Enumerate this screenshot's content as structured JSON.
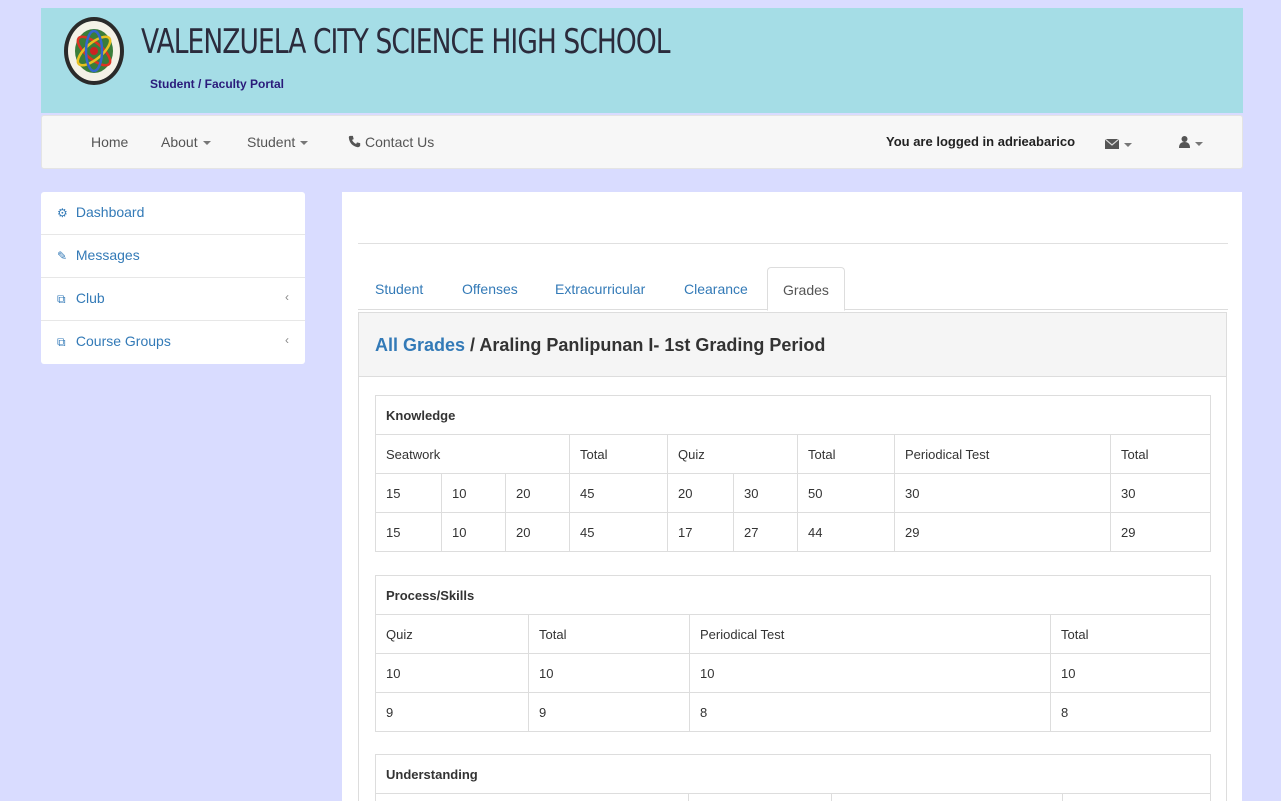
{
  "header": {
    "school_name": "VALENZUELA CITY SCIENCE HIGH SCHOOL",
    "subtitle": "Student / Faculty Portal",
    "logo_icon": "school-seal"
  },
  "nav": {
    "home": "Home",
    "about": "About",
    "student": "Student",
    "contact": "Contact Us",
    "logged_in": "You are logged in adrieabarico",
    "mail_icon": "envelope-icon",
    "user_icon": "user-icon"
  },
  "sidebar": {
    "items": [
      {
        "label": "Dashboard",
        "icon": "dashboard-icon"
      },
      {
        "label": "Messages",
        "icon": "edit-icon"
      },
      {
        "label": "Club",
        "icon": "copy-icon"
      },
      {
        "label": "Course Groups",
        "icon": "copy-icon"
      }
    ]
  },
  "tabs": [
    "Student",
    "Offenses",
    "Extracurricular",
    "Clearance",
    "Grades"
  ],
  "panel": {
    "link": "All Grades",
    "title": " / Araling Panlipunan I- 1st Grading Period"
  },
  "knowledge": {
    "title": "Knowledge",
    "headers": [
      "Seatwork",
      "Total",
      "Quiz",
      "Total",
      "Periodical Test",
      "Total"
    ],
    "rows": [
      [
        "15",
        "10",
        "20",
        "45",
        "20",
        "30",
        "50",
        "30",
        "30"
      ],
      [
        "15",
        "10",
        "20",
        "45",
        "17",
        "27",
        "44",
        "29",
        "29"
      ]
    ]
  },
  "process": {
    "title": "Process/Skills",
    "headers": [
      "Quiz",
      "Total",
      "Periodical Test",
      "Total"
    ],
    "rows": [
      [
        "10",
        "10",
        "10",
        "10"
      ],
      [
        "9",
        "9",
        "8",
        "8"
      ]
    ]
  },
  "understanding": {
    "title": "Understanding"
  },
  "colors": {
    "background": "#d9dcff",
    "header": "#a5dde6",
    "link": "#337ab7"
  }
}
